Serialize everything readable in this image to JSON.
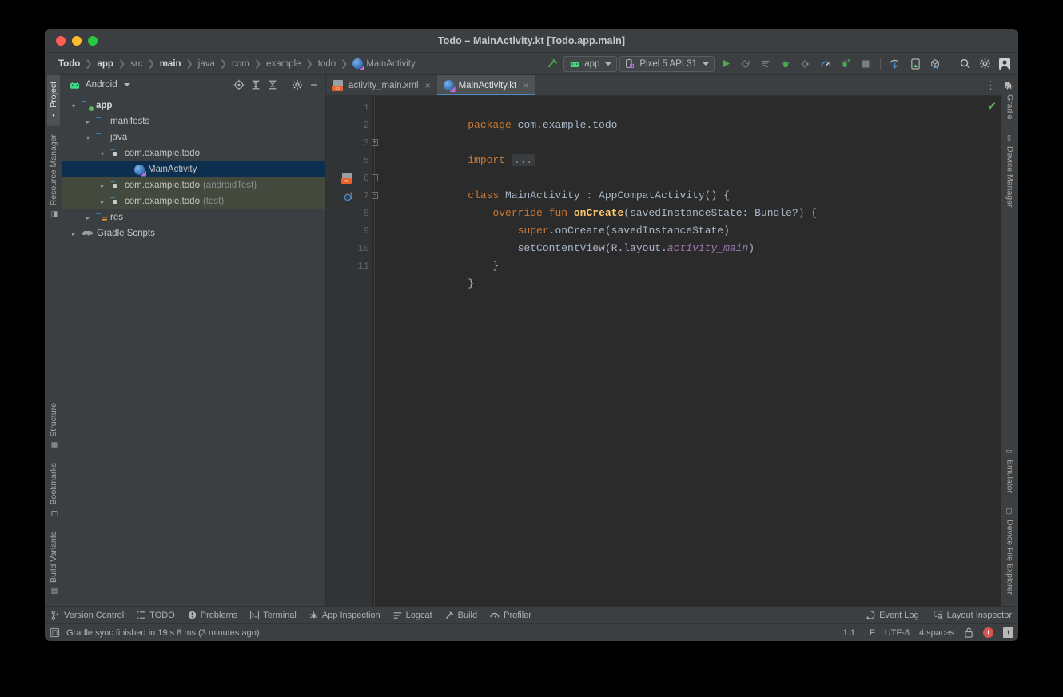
{
  "window": {
    "title": "Todo – MainActivity.kt [Todo.app.main]",
    "traffic": {
      "close": "close-button",
      "minimize": "minimize-button",
      "zoom": "zoom-button"
    }
  },
  "breadcrumbs": [
    {
      "label": "Todo",
      "strong": true
    },
    {
      "label": "app",
      "strong": true
    },
    {
      "label": "src",
      "strong": false
    },
    {
      "label": "main",
      "strong": true
    },
    {
      "label": "java",
      "strong": false
    },
    {
      "label": "com",
      "strong": false
    },
    {
      "label": "example",
      "strong": false
    },
    {
      "label": "todo",
      "strong": false
    },
    {
      "label": "MainActivity",
      "strong": false,
      "icon": "kotlin-class-icon"
    }
  ],
  "toolbar": {
    "build_icon": "hammer-icon",
    "run_config": {
      "label": "app",
      "icon": "android-robot-icon"
    },
    "device": {
      "label": "Pixel 5 API 31",
      "icon": "device-icon"
    },
    "actions": [
      {
        "name": "run-button",
        "glyph": "▶"
      },
      {
        "name": "apply-changes-button",
        "glyph": "↻"
      },
      {
        "name": "run-with-coverage-button",
        "glyph": "≡"
      },
      {
        "name": "debug-button",
        "glyph": "🐞"
      },
      {
        "name": "attach-debugger-button",
        "glyph": "▷"
      },
      {
        "name": "profiler-button",
        "glyph": "◔"
      },
      {
        "name": "profile-app-button",
        "glyph": "✦"
      },
      {
        "name": "stop-button",
        "glyph": "■"
      },
      {
        "name": "sync-gradle-button",
        "glyph": "⟳"
      },
      {
        "name": "avd-manager-button",
        "glyph": "▭"
      },
      {
        "name": "sdk-manager-button",
        "glyph": "▣"
      },
      {
        "name": "search-everywhere-button",
        "glyph": "⌕"
      },
      {
        "name": "settings-button",
        "glyph": "⚙"
      },
      {
        "name": "account-button",
        "glyph": "👤"
      }
    ]
  },
  "left_stripe": {
    "top": [
      {
        "label": "Project",
        "icon": "project-icon",
        "active": true
      },
      {
        "label": "Resource Manager",
        "icon": "resource-manager-icon",
        "active": false
      }
    ],
    "bottom": [
      {
        "label": "Structure",
        "icon": "structure-icon",
        "active": false
      },
      {
        "label": "Bookmarks",
        "icon": "bookmarks-icon",
        "active": false
      },
      {
        "label": "Build Variants",
        "icon": "build-variants-icon",
        "active": false
      }
    ]
  },
  "right_stripe": {
    "top": [
      {
        "label": "Gradle",
        "icon": "gradle-elephant-icon"
      },
      {
        "label": "Device Manager",
        "icon": "device-manager-icon"
      }
    ],
    "bottom": [
      {
        "label": "Emulator",
        "icon": "emulator-icon"
      },
      {
        "label": "Device File Explorer",
        "icon": "device-file-explorer-icon"
      }
    ]
  },
  "project_panel": {
    "view_title": "Android",
    "tools": [
      {
        "name": "select-opened-file-button",
        "glyph": "⊕"
      },
      {
        "name": "expand-all-button",
        "glyph": "⤒"
      },
      {
        "name": "collapse-all-button",
        "glyph": "⤓"
      },
      {
        "name": "settings-gear-button",
        "glyph": "⚙"
      },
      {
        "name": "hide-panel-button",
        "glyph": "—"
      }
    ],
    "tree": [
      {
        "label": "app",
        "suffix": "",
        "indent": 0,
        "state": "open",
        "icon": "android-module-icon",
        "bold": true,
        "selected": false,
        "test": false
      },
      {
        "label": "manifests",
        "suffix": "",
        "indent": 1,
        "state": "closed",
        "icon": "folder-icon",
        "bold": false,
        "selected": false,
        "test": false
      },
      {
        "label": "java",
        "suffix": "",
        "indent": 1,
        "state": "open",
        "icon": "folder-icon",
        "bold": false,
        "selected": false,
        "test": false
      },
      {
        "label": "com.example.todo",
        "suffix": "",
        "indent": 2,
        "state": "open",
        "icon": "package-icon",
        "bold": false,
        "selected": false,
        "test": false
      },
      {
        "label": "MainActivity",
        "suffix": "",
        "indent": 3,
        "state": "none",
        "icon": "kotlin-class-icon",
        "bold": false,
        "selected": true,
        "test": false
      },
      {
        "label": "com.example.todo",
        "suffix": "(androidTest)",
        "indent": 2,
        "state": "closed",
        "icon": "package-icon",
        "bold": false,
        "selected": false,
        "test": true
      },
      {
        "label": "com.example.todo",
        "suffix": "(test)",
        "indent": 2,
        "state": "closed",
        "icon": "package-icon",
        "bold": false,
        "selected": false,
        "test": true
      },
      {
        "label": "res",
        "suffix": "",
        "indent": 1,
        "state": "closed",
        "icon": "res-folder-icon",
        "bold": false,
        "selected": false,
        "test": false
      },
      {
        "label": "Gradle Scripts",
        "suffix": "",
        "indent": 0,
        "state": "closed",
        "icon": "gradle-elephant-icon",
        "bold": false,
        "selected": false,
        "test": false
      }
    ]
  },
  "editor": {
    "tabs": [
      {
        "label": "activity_main.xml",
        "icon": "layout-xml-icon",
        "active": false,
        "close": "×"
      },
      {
        "label": "MainActivity.kt",
        "icon": "kotlin-class-icon",
        "active": true,
        "close": "×"
      }
    ],
    "tab_options_glyph": "⋮",
    "inspection_status": "✔",
    "line_numbers": [
      "1",
      "2",
      "3",
      "5",
      "6",
      "7",
      "8",
      "9",
      "10",
      "11"
    ],
    "gutter_marks": [
      {
        "line": "6",
        "name": "related-layout-icon"
      },
      {
        "line": "7",
        "name": "overriding-method-icon"
      }
    ],
    "code_lines": [
      {
        "n": "1",
        "tokens": [
          {
            "t": "package ",
            "c": "kw"
          },
          {
            "t": "com.example.todo",
            "c": "id"
          }
        ]
      },
      {
        "n": "2",
        "tokens": []
      },
      {
        "n": "3",
        "fold": "+",
        "tokens": [
          {
            "t": "import ",
            "c": "kw"
          },
          {
            "t": "...",
            "c": "ellipsis"
          }
        ]
      },
      {
        "n": "5",
        "tokens": []
      },
      {
        "n": "6",
        "fold": "-",
        "tokens": [
          {
            "t": "class ",
            "c": "kw"
          },
          {
            "t": "MainActivity",
            "c": "id"
          },
          {
            "t": " : ",
            "c": "id"
          },
          {
            "t": "AppCompatActivity() {",
            "c": "id"
          }
        ]
      },
      {
        "n": "7",
        "fold": "-",
        "tokens": [
          {
            "t": "    ",
            "c": "id"
          },
          {
            "t": "override fun ",
            "c": "kw"
          },
          {
            "t": "onCreate",
            "c": "fn"
          },
          {
            "t": "(savedInstanceState: Bundle?) {",
            "c": "id"
          }
        ]
      },
      {
        "n": "8",
        "tokens": [
          {
            "t": "        ",
            "c": "id"
          },
          {
            "t": "super",
            "c": "kw"
          },
          {
            "t": ".onCreate(savedInstanceState)",
            "c": "id"
          }
        ]
      },
      {
        "n": "9",
        "tokens": [
          {
            "t": "        setContentView(R.layout.",
            "c": "id"
          },
          {
            "t": "activity_main",
            "c": "prop"
          },
          {
            "t": ")",
            "c": "id"
          }
        ]
      },
      {
        "n": "10",
        "fold": "-",
        "tokens": [
          {
            "t": "    }",
            "c": "id"
          }
        ]
      },
      {
        "n": "11",
        "fold": "-",
        "tokens": [
          {
            "t": "}",
            "c": "id"
          }
        ]
      }
    ],
    "intention_bulb": "intention-bulb-icon"
  },
  "bottom_bar": {
    "left": [
      {
        "label": "Version Control",
        "icon": "version-control-icon"
      },
      {
        "label": "TODO",
        "icon": "todo-icon"
      },
      {
        "label": "Problems",
        "icon": "problems-icon"
      },
      {
        "label": "Terminal",
        "icon": "terminal-icon"
      },
      {
        "label": "App Inspection",
        "icon": "app-inspection-icon"
      },
      {
        "label": "Logcat",
        "icon": "logcat-icon"
      },
      {
        "label": "Build",
        "icon": "build-hammer-icon"
      },
      {
        "label": "Profiler",
        "icon": "profiler-icon"
      }
    ],
    "right": [
      {
        "label": "Event Log",
        "icon": "event-log-icon"
      },
      {
        "label": "Layout Inspector",
        "icon": "layout-inspector-icon"
      }
    ]
  },
  "status_bar": {
    "message_icon": "status-message-icon",
    "message": "Gradle sync finished in 19 s 8 ms (3 minutes ago)",
    "caret_position": "1:1",
    "line_separator": "LF",
    "encoding": "UTF-8",
    "indent": "4 spaces",
    "lock_icon": "unlocked-icon",
    "error_badge": "!",
    "notification_badge": "!"
  },
  "colors": {
    "window_chrome": "#3c3f41",
    "editor_bg": "#2b2b2b",
    "gutter_bg": "#313335",
    "selection_blue": "#0d2f4f",
    "test_source_green": "#43493d",
    "accent_tab": "#4a88c7",
    "keyword_orange": "#cc7832",
    "function_yellow": "#ffc66d",
    "property_purple": "#9876aa",
    "text_default": "#a9b7c6",
    "run_green": "#4fa84f"
  }
}
